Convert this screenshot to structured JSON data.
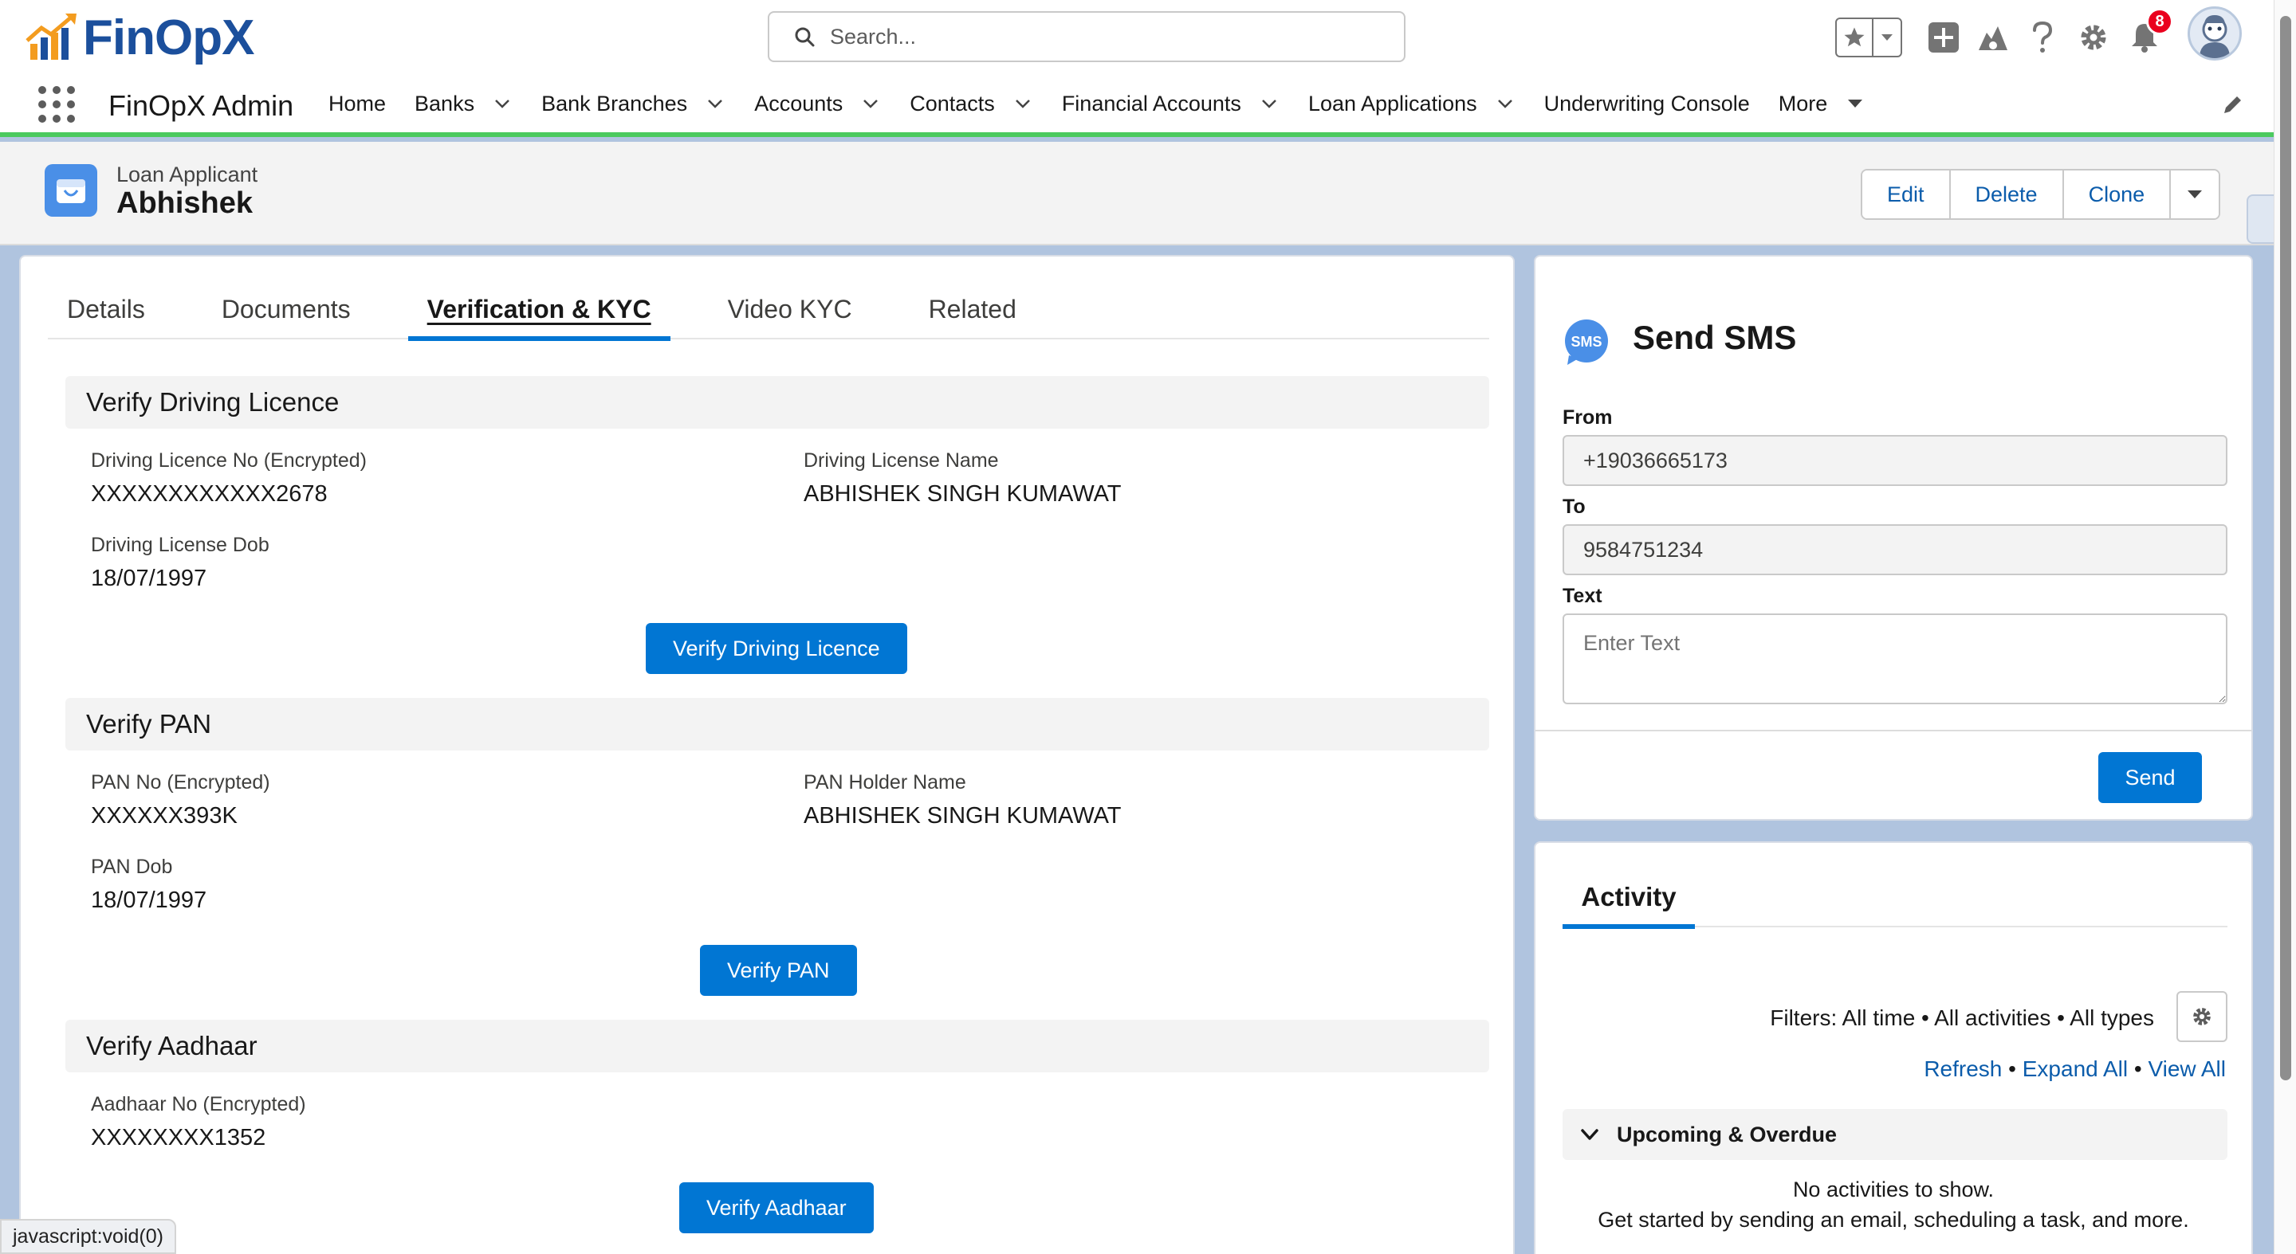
{
  "header": {
    "logo_text": "FinOpX",
    "search_placeholder": "Search...",
    "notification_count": "8"
  },
  "nav": {
    "app_name": "FinOpX Admin",
    "items": [
      {
        "label": "Home",
        "dropdown": false
      },
      {
        "label": "Banks",
        "dropdown": true
      },
      {
        "label": "Bank Branches",
        "dropdown": true
      },
      {
        "label": "Accounts",
        "dropdown": true
      },
      {
        "label": "Contacts",
        "dropdown": true
      },
      {
        "label": "Financial Accounts",
        "dropdown": true
      },
      {
        "label": "Loan Applications",
        "dropdown": true
      },
      {
        "label": "Underwriting Console",
        "dropdown": false
      },
      {
        "label": "More",
        "dropdown": true
      }
    ]
  },
  "record": {
    "type": "Loan Applicant",
    "name": "Abhishek",
    "actions": {
      "edit": "Edit",
      "delete": "Delete",
      "clone": "Clone"
    }
  },
  "tabs": [
    "Details",
    "Documents",
    "Verification & KYC",
    "Video KYC",
    "Related"
  ],
  "active_tab": "Verification & KYC",
  "sections": {
    "driving": {
      "title": "Verify Driving Licence",
      "licence_no_label": "Driving Licence No (Encrypted)",
      "licence_no_value": "XXXXXXXXXXXX2678",
      "name_label": "Driving License Name",
      "name_value": "ABHISHEK SINGH KUMAWAT",
      "dob_label": "Driving License Dob",
      "dob_value": "18/07/1997",
      "button": "Verify Driving Licence"
    },
    "pan": {
      "title": "Verify PAN",
      "pan_no_label": "PAN No (Encrypted)",
      "pan_no_value": "XXXXXX393K",
      "holder_label": "PAN Holder Name",
      "holder_value": "ABHISHEK SINGH KUMAWAT",
      "dob_label": "PAN Dob",
      "dob_value": "18/07/1997",
      "button": "Verify PAN"
    },
    "aadhaar": {
      "title": "Verify Aadhaar",
      "no_label": "Aadhaar No (Encrypted)",
      "no_value": "XXXXXXXX1352",
      "button": "Verify Aadhaar"
    }
  },
  "sms": {
    "title": "Send SMS",
    "from_label": "From",
    "from_value": "+19036665173",
    "to_label": "To",
    "to_value": "9584751234",
    "text_label": "Text",
    "text_placeholder": "Enter Text",
    "send": "Send"
  },
  "activity": {
    "tab": "Activity",
    "filters": "Filters: All time • All activities • All types",
    "refresh": "Refresh",
    "expand_all": "Expand All",
    "view_all": "View All",
    "upcoming": "Upcoming & Overdue",
    "empty_line1": "No activities to show.",
    "empty_line2": "Get started by sending an email, scheduling a task, and more."
  },
  "status_url": "javascript:void(0)",
  "colors": {
    "brand": "#0176d3",
    "nav_accent": "#4bca5e",
    "logo_blue": "#1b4f9c",
    "badge_red": "#ea001e"
  }
}
